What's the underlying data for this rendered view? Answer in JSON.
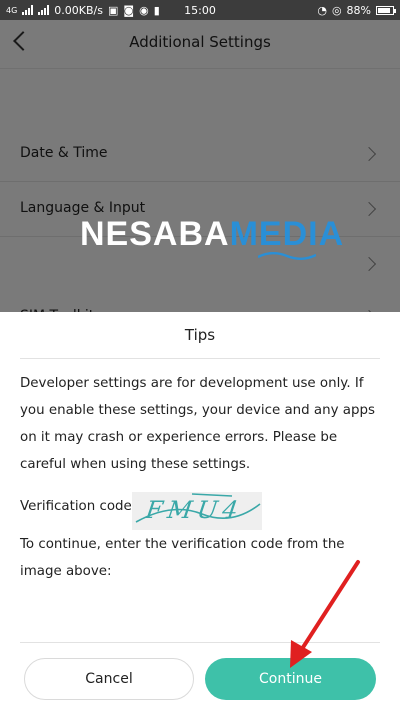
{
  "status_bar": {
    "network": "4G",
    "speed": "0.00KB/s",
    "time": "15:00",
    "battery": "88%"
  },
  "page": {
    "title": "Additional Settings",
    "rows": [
      {
        "label": "Date & Time"
      },
      {
        "label": "Language & Input"
      },
      {
        "label": ""
      },
      {
        "label": "SIM Toolkit"
      }
    ]
  },
  "watermark": {
    "part1": "NESABA",
    "part2": "MEDIA"
  },
  "dialog": {
    "title": "Tips",
    "message": "Developer settings are for development use only. If you enable these settings, your device and any apps on it may crash or experience errors. Please be careful when using these settings.",
    "verification_label": "Verification code:",
    "captcha_text": "FMU4",
    "hint": "To continue, enter the verification code from the image above:",
    "cancel_label": "Cancel",
    "continue_label": "Continue"
  },
  "colors": {
    "accent": "#3ec1a9",
    "arrow": "#e02020",
    "captcha": "#3aa8a8"
  }
}
